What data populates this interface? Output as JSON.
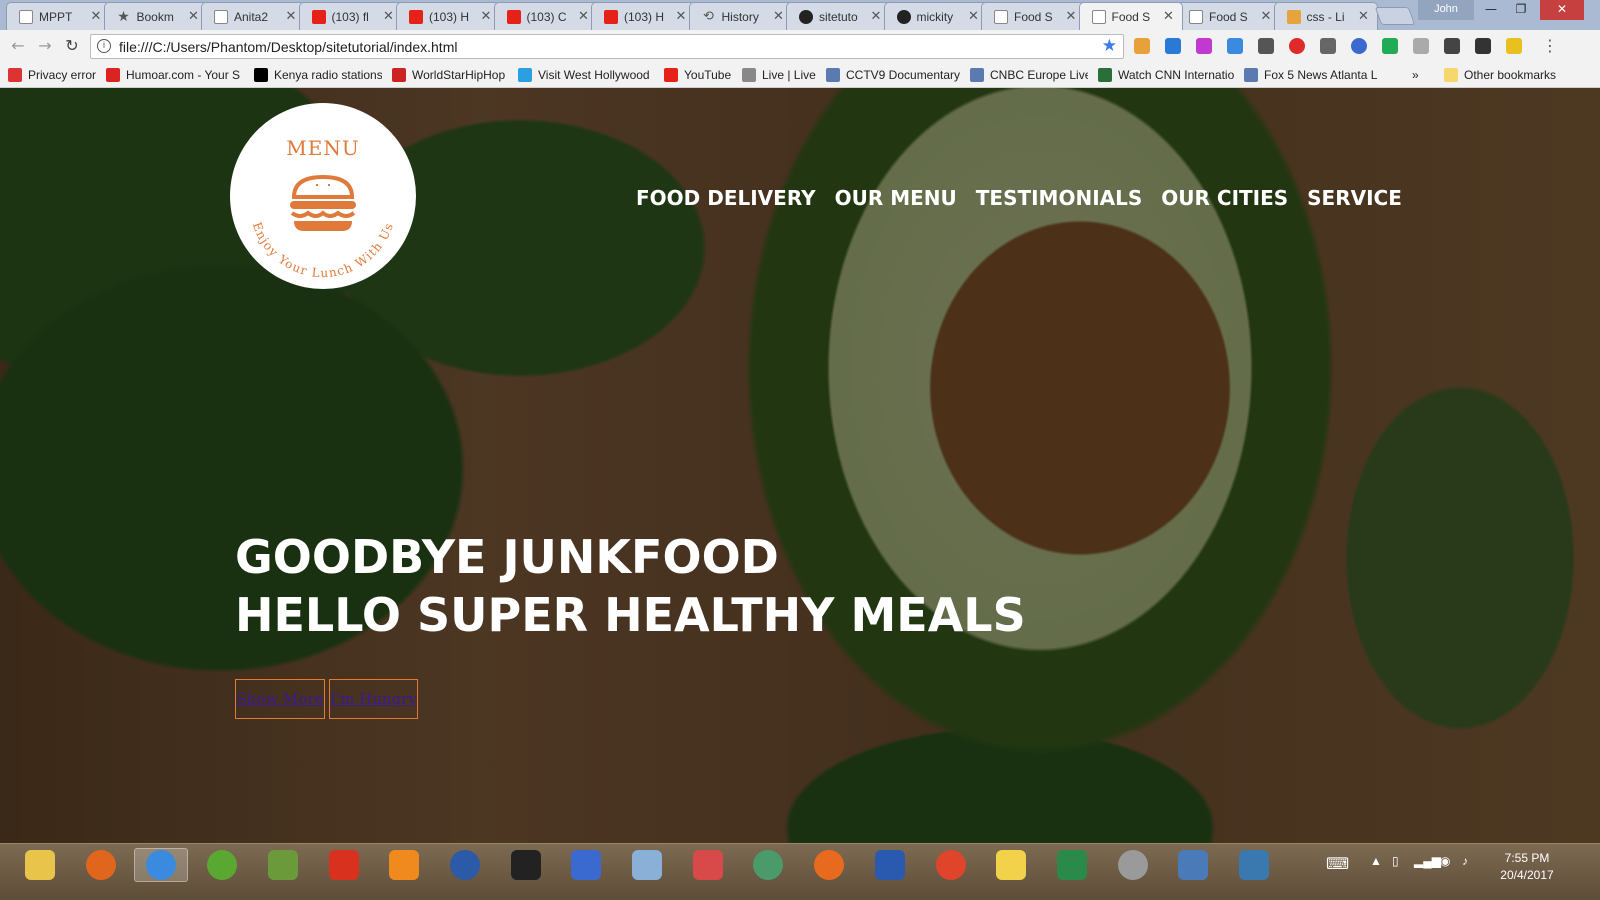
{
  "browser": {
    "tabs": [
      {
        "title": "MPPT",
        "icon": "doc"
      },
      {
        "title": "Bookm",
        "icon": "star"
      },
      {
        "title": "Anita2",
        "icon": "doc"
      },
      {
        "title": "(103) fl",
        "icon": "yt"
      },
      {
        "title": "(103) H",
        "icon": "yt"
      },
      {
        "title": "(103) C",
        "icon": "yt"
      },
      {
        "title": "(103) H",
        "icon": "yt"
      },
      {
        "title": "History",
        "icon": "hist"
      },
      {
        "title": "sitetuto",
        "icon": "gh"
      },
      {
        "title": "mickity",
        "icon": "gh"
      },
      {
        "title": "Food S",
        "icon": "doc"
      },
      {
        "title": "Food S",
        "icon": "doc",
        "active": true
      },
      {
        "title": "Food S",
        "icon": "doc"
      },
      {
        "title": "css - Li",
        "icon": "css"
      }
    ],
    "user": "John",
    "url": "file:///C:/Users/Phantom/Desktop/sitetutorial/index.html",
    "bookmarks": [
      {
        "label": "Privacy error",
        "color": "#d33"
      },
      {
        "label": "Humoar.com - Your S",
        "color": "#d22"
      },
      {
        "label": "Kenya radio stations",
        "color": "#000"
      },
      {
        "label": "WorldStarHipHop",
        "color": "#c22"
      },
      {
        "label": "Visit West Hollywood",
        "color": "#2aa0e0"
      },
      {
        "label": "YouTube",
        "color": "#e62117"
      },
      {
        "label": "Live | Live",
        "color": "#888"
      },
      {
        "label": "CCTV9 Documentary",
        "color": "#5a7ab0"
      },
      {
        "label": "CNBC Europe Live",
        "color": "#5a7ab0"
      },
      {
        "label": "Watch CNN Internatio",
        "color": "#2a6e3a"
      },
      {
        "label": "Fox 5 News Atlanta Li",
        "color": "#5a7ab0"
      }
    ],
    "more_bookmarks": "»",
    "other_bookmarks": "Other bookmarks"
  },
  "site": {
    "logo_title": "MENU",
    "logo_tagline": "Enjoy Your Lunch With Us",
    "nav": [
      "FOOD DELIVERY",
      "OUR MENU",
      "TESTIMONIALS",
      "OUR CITIES",
      "SERVICE"
    ],
    "hero_line1": "GOODBYE JUNKFOOD",
    "hero_line2": "HELLO SUPER HEALTHY MEALS",
    "btn_show_more": "Show More",
    "btn_hungry": "I'm Hungry",
    "accent_color": "#e07a3a"
  },
  "taskbar": {
    "apps": [
      "file-explorer",
      "firefox",
      "chrome",
      "utorrent",
      "network-app",
      "screen-recorder",
      "vlc",
      "app-crescent",
      "camera-app",
      "notepad",
      "sticky-app",
      "gem-app",
      "atom",
      "orange-app",
      "word",
      "picasa",
      "sticky-notes",
      "excel",
      "disc-app",
      "calculator",
      "photo-viewer"
    ],
    "time": "7:55 PM",
    "date": "20/4/2017"
  }
}
